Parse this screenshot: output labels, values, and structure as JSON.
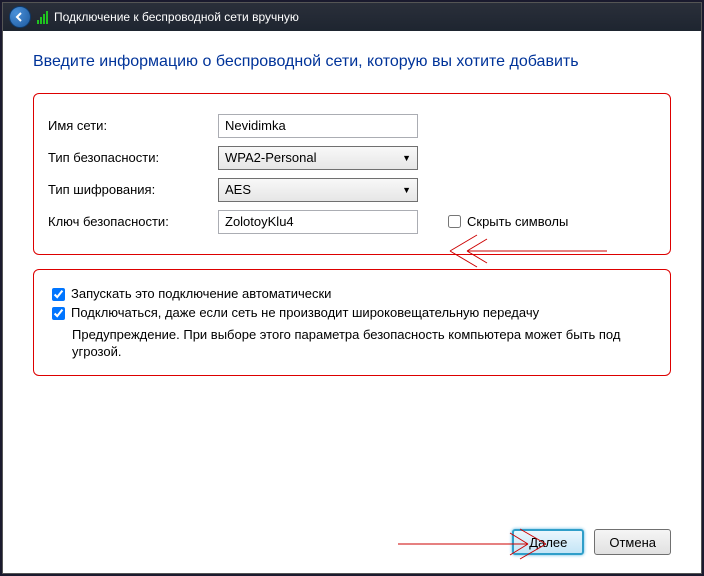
{
  "titlebar": {
    "title": "Подключение к беспроводной сети вручную"
  },
  "heading": "Введите информацию о беспроводной сети, которую вы хотите добавить",
  "form": {
    "network_name_label": "Имя сети:",
    "network_name_value": "Nevidimka",
    "security_type_label": "Тип безопасности:",
    "security_type_value": "WPA2-Personal",
    "encryption_type_label": "Тип шифрования:",
    "encryption_type_value": "AES",
    "security_key_label": "Ключ безопасности:",
    "security_key_value": "ZolotoyKlu4",
    "hide_chars_label": "Скрыть символы"
  },
  "options": {
    "auto_connect_label": "Запускать это подключение автоматически",
    "connect_hidden_label": "Подключаться, даже если сеть не производит широковещательную передачу",
    "warning": "Предупреждение. При выборе этого параметра безопасность компьютера может быть под угрозой."
  },
  "buttons": {
    "next": "Далее",
    "cancel": "Отмена"
  }
}
